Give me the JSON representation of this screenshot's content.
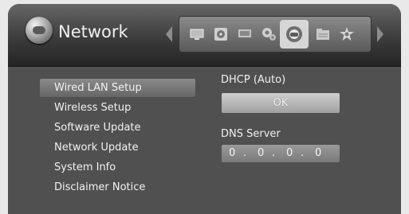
{
  "header": {
    "title": "Network",
    "title_icon": "network-globe-icon",
    "icons": [
      "tv-icon",
      "disc-icon",
      "display-icon",
      "settings-gear-icon",
      "network-globe-icon",
      "folder-icon",
      "star-gear-icon"
    ],
    "selected_icon": "network-globe-icon"
  },
  "menu": {
    "items": [
      {
        "label": "Wired LAN Setup",
        "selected": true
      },
      {
        "label": "Wireless Setup",
        "selected": false
      },
      {
        "label": "Software Update",
        "selected": false
      },
      {
        "label": "Network Update",
        "selected": false
      },
      {
        "label": "System Info",
        "selected": false
      },
      {
        "label": "Disclaimer Notice",
        "selected": false
      }
    ]
  },
  "settings": {
    "dhcp_label": "DHCP (Auto)",
    "ok_label": "OK",
    "dns_label": "DNS Server",
    "dns_octets": [
      "0",
      "0",
      "0",
      "0"
    ],
    "dns_separator": "."
  }
}
